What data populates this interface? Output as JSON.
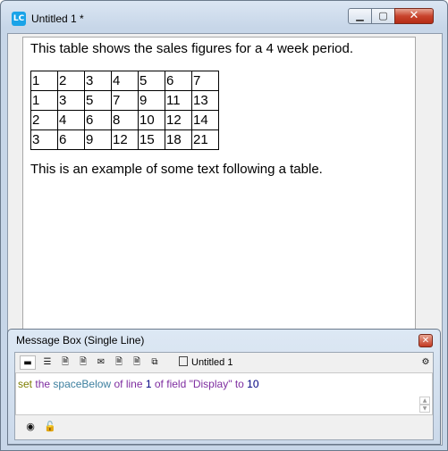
{
  "window": {
    "title": "Untitled 1 *",
    "app_icon_text": "LC",
    "controls": {
      "minimize": "▁",
      "maximize": "▢",
      "close": "✕"
    }
  },
  "field": {
    "intro": "This table shows the sales figures for a 4 week period.",
    "table": [
      [
        "1",
        "2",
        "3",
        "4",
        "5",
        "6",
        "7"
      ],
      [
        "1",
        "3",
        "5",
        "7",
        "9",
        "11",
        "13"
      ],
      [
        "2",
        "4",
        "6",
        "8",
        "10",
        "12",
        "14"
      ],
      [
        "3",
        "6",
        "9",
        "12",
        "15",
        "18",
        "21"
      ]
    ],
    "outro": "This is an example of some text following a table."
  },
  "message_box": {
    "title": "Message Box (Single Line)",
    "close_label": "✕",
    "stack_label": "Untitled 1",
    "toolbar_icons": [
      "single-line-icon",
      "multiple-lines-icon",
      "global-properties-icon",
      "global-variables-icon",
      "pending-messages-icon",
      "frontscripts-icon",
      "backscripts-icon",
      "libraries-icon"
    ],
    "command": {
      "kw_set": "set",
      "the": "the",
      "prop": "spaceBelow",
      "of1": "of",
      "line": "line",
      "num": "1",
      "of2": "of",
      "field": "field",
      "str": "\"Display\"",
      "to": "to",
      "value": "10"
    }
  }
}
